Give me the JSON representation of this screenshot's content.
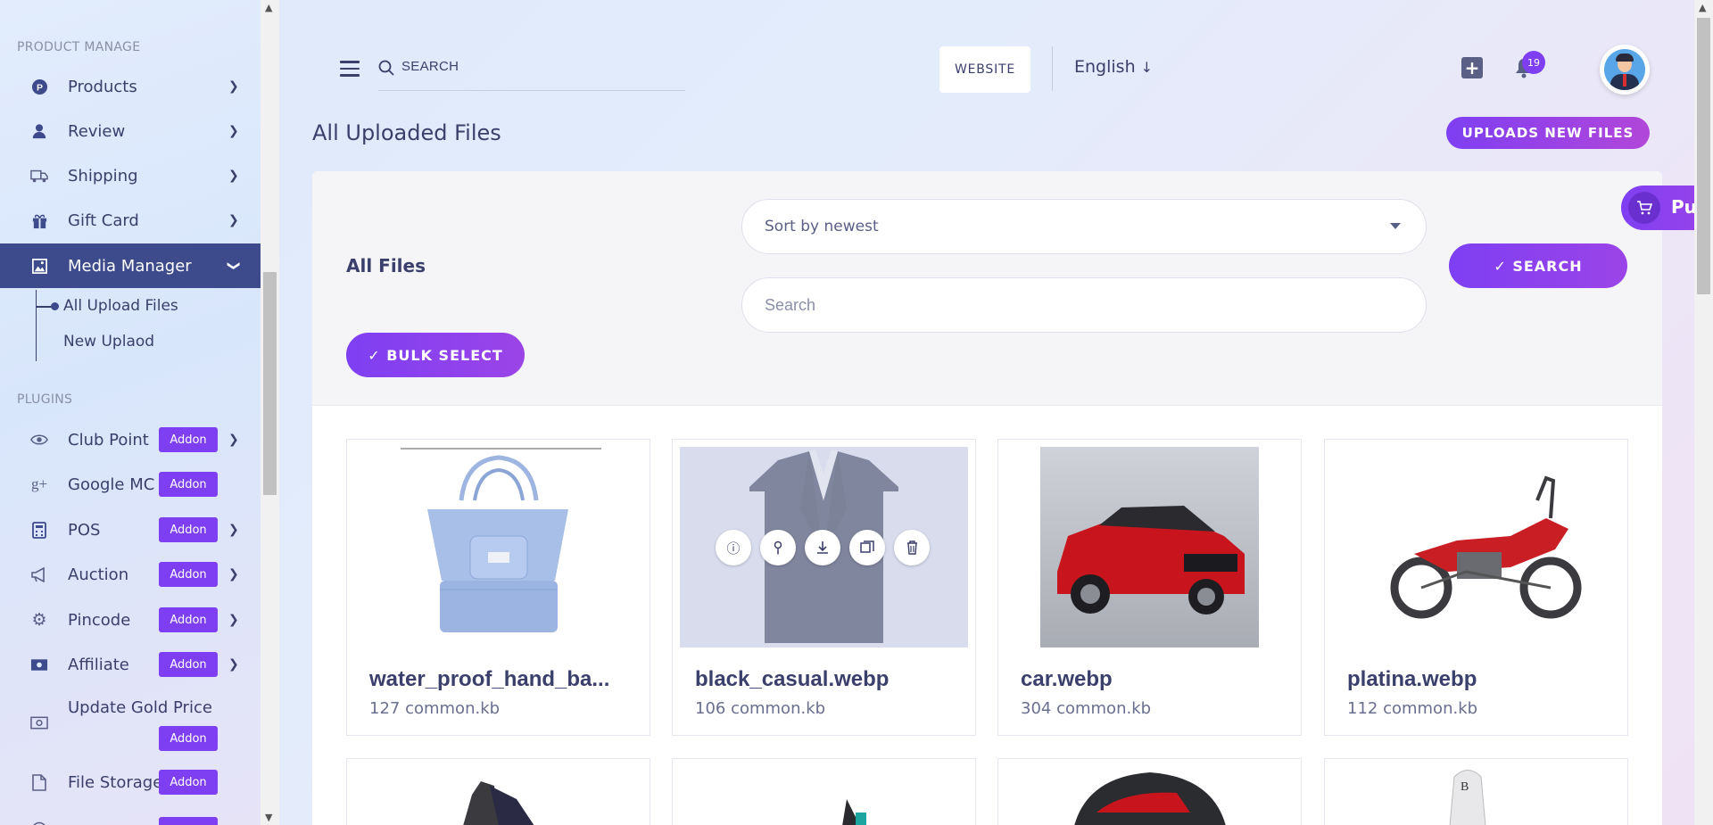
{
  "sidebar": {
    "section_product": "PRODUCT MANAGE",
    "section_plugins": "PLUGINS",
    "items": [
      {
        "label": "Products",
        "icon": "products-icon"
      },
      {
        "label": "Review",
        "icon": "user-icon"
      },
      {
        "label": "Shipping",
        "icon": "truck-icon"
      },
      {
        "label": "Gift Card",
        "icon": "gift-icon"
      },
      {
        "label": "Media Manager",
        "icon": "image-icon"
      }
    ],
    "sub_items": [
      "All Upload Files",
      "New Uplaod"
    ],
    "plugins": [
      {
        "label": "Club Point",
        "addon": "Addon"
      },
      {
        "label": "Google MC",
        "addon": "Addon"
      },
      {
        "label": "POS",
        "addon": "Addon"
      },
      {
        "label": "Auction",
        "addon": "Addon"
      },
      {
        "label": "Pincode",
        "addon": "Addon"
      },
      {
        "label": "Affiliate",
        "addon": "Addon"
      },
      {
        "label": "Update Gold Price",
        "addon": "Addon"
      },
      {
        "label": "File Storage",
        "addon": "Addon"
      }
    ]
  },
  "topbar": {
    "search_placeholder": "SEARCH",
    "website_label": "WEBSITE",
    "language": "English",
    "notification_count": "19"
  },
  "page": {
    "title": "All Uploaded Files",
    "upload_button": "UPLOADS NEW FILES",
    "all_files": "All Files",
    "sort_value": "Sort by newest",
    "search_placeholder": "Search",
    "search_button": "SEARCH",
    "bulk_button": "BULK SELECT",
    "floating_label": "Pu"
  },
  "files": [
    {
      "name": "water_proof_hand_ba...",
      "size": "127 common.kb"
    },
    {
      "name": "black_casual.webp",
      "size": "106 common.kb"
    },
    {
      "name": "car.webp",
      "size": "304 common.kb"
    },
    {
      "name": "platina.webp",
      "size": "112 common.kb"
    }
  ],
  "colors": {
    "accent": "#7e3ff2",
    "sidebar_active": "#3d4a8c",
    "text": "#3a3f6b"
  }
}
